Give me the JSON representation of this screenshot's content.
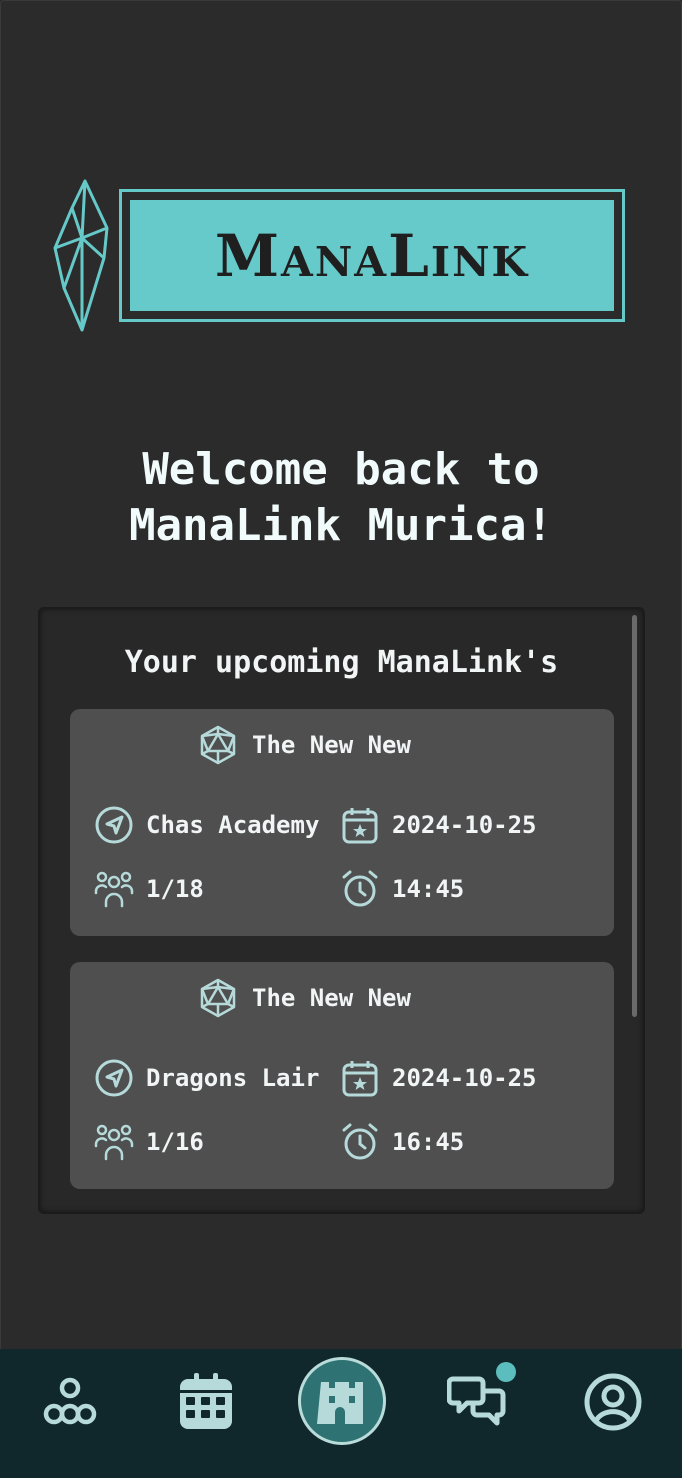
{
  "brand": {
    "logo_text": "ManaLink",
    "accent_color": "#67caca"
  },
  "welcome": {
    "line1": "Welcome back to",
    "line2": "ManaLink Murica!"
  },
  "upcoming": {
    "title": "Your upcoming ManaLink's",
    "events": [
      {
        "name": "The New New",
        "venue": "Chas Academy",
        "date": "2024-10-25",
        "players": "1/18",
        "time": "14:45"
      },
      {
        "name": "The New New",
        "venue": "Dragons Lair",
        "date": "2024-10-25",
        "players": "1/16",
        "time": "16:45"
      }
    ]
  },
  "nav": {
    "items": [
      "network-icon",
      "calendar-icon",
      "castle-icon",
      "chat-icon",
      "profile-icon"
    ],
    "active": "castle-icon",
    "chat_has_notification": true
  }
}
